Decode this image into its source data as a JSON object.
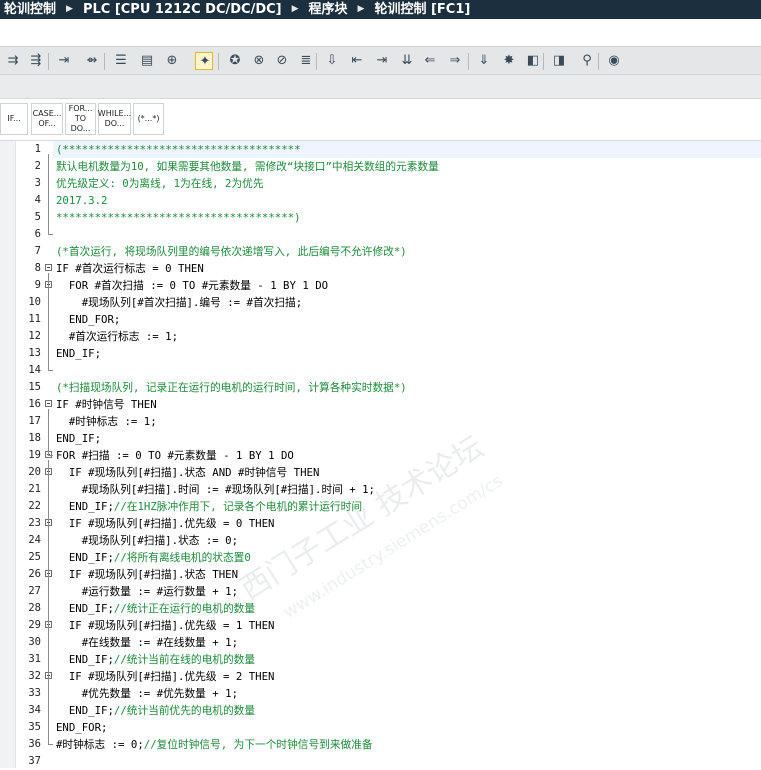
{
  "breadcrumb": {
    "items": [
      "轮训控制",
      "PLC [CPU 1212C DC/DC/DC]",
      "程序块",
      "轮训控制 [FC1]"
    ]
  },
  "toolbar": {
    "icons": [
      "insert-network-icon",
      "delete-network-icon",
      "jump-icon",
      "jump-end-icon",
      "align-left-icon",
      "list-icon",
      "monitor-icon",
      "toggle-icon",
      "absolute-operand-icon",
      "block-call-icon",
      "declaration-icon",
      "list-view-icon",
      "download-icon",
      "indent-increase-icon",
      "indent-decrease-icon",
      "align-icon",
      "comment-icon",
      "uncomment-icon",
      "bookmark-icon",
      "prev-bookmark-icon",
      "next-bookmark-icon",
      "find-icon",
      "watch-icon",
      "settings-icon"
    ]
  },
  "snippets": [
    {
      "label": "IF...",
      "line2": ""
    },
    {
      "label": "CASE...",
      "line2": "OF..."
    },
    {
      "label": "FOR...",
      "line2": "TO DO..."
    },
    {
      "label": "WHILE...",
      "line2": "DO..."
    },
    {
      "label": "(*...*)",
      "line2": ""
    }
  ],
  "watermark": {
    "text1": "西门子工业  技术论坛",
    "text2": "www.industry.siemens.com/cs"
  },
  "code": [
    {
      "n": "1",
      "t": "(*************************************",
      "c": true,
      "f": false
    },
    {
      "n": "2",
      "t": "默认电机数量为10, 如果需要其他数量, 需修改“块接口”中相关数组的元素数量",
      "c": true
    },
    {
      "n": "3",
      "t": "优先级定义: 0为离线, 1为在线, 2为优先",
      "c": true
    },
    {
      "n": "4",
      "t": "2017.3.2",
      "c": true
    },
    {
      "n": "5",
      "t": "*************************************)",
      "c": true
    },
    {
      "n": "6",
      "t": ""
    },
    {
      "n": "7",
      "t": "(*首次运行, 将现场队列里的编号依次递增写入, 此后编号不允许修改*)",
      "c": true
    },
    {
      "n": "8",
      "t": "IF #首次运行标志 = 0 THEN",
      "f": true
    },
    {
      "n": "9",
      "t": "  FOR #首次扫描 := 0 TO #元素数量 - 1 BY 1 DO",
      "f": true
    },
    {
      "n": "10",
      "t": "    #现场队列[#首次扫描].编号 := #首次扫描;"
    },
    {
      "n": "11",
      "t": "  END_FOR;"
    },
    {
      "n": "12",
      "t": "  #首次运行标志 := 1;"
    },
    {
      "n": "13",
      "t": "END_IF;"
    },
    {
      "n": "14",
      "t": ""
    },
    {
      "n": "15",
      "t": "(*扫描现场队列, 记录正在运行的电机的运行时间, 计算各种实时数据*)",
      "c": true
    },
    {
      "n": "16",
      "t": "IF #时钟信号 THEN",
      "f": true
    },
    {
      "n": "17",
      "t": "  #时钟标志 := 1;"
    },
    {
      "n": "18",
      "t": "END_IF;"
    },
    {
      "n": "19",
      "t": "FOR #扫描 := 0 TO #元素数量 - 1 BY 1 DO",
      "f": true
    },
    {
      "n": "20",
      "t": "  IF #现场队列[#扫描].状态 AND #时钟信号 THEN",
      "f": true
    },
    {
      "n": "21",
      "t": "    #现场队列[#扫描].时间 := #现场队列[#扫描].时间 + 1;"
    },
    {
      "n": "22",
      "t": "  END_IF;",
      "cm": "//在1HZ脉冲作用下, 记录各个电机的累计运行时间"
    },
    {
      "n": "23",
      "t": "  IF #现场队列[#扫描].优先级 = 0 THEN",
      "f": true
    },
    {
      "n": "24",
      "t": "    #现场队列[#扫描].状态 := 0;"
    },
    {
      "n": "25",
      "t": "  END_IF;",
      "cm": "//将所有离线电机的状态置0"
    },
    {
      "n": "26",
      "t": "  IF #现场队列[#扫描].状态 THEN",
      "f": true
    },
    {
      "n": "27",
      "t": "    #运行数量 := #运行数量 + 1;"
    },
    {
      "n": "28",
      "t": "  END_IF;",
      "cm": "//统计正在运行的电机的数量"
    },
    {
      "n": "29",
      "t": "  IF #现场队列[#扫描].优先级 = 1 THEN",
      "f": true
    },
    {
      "n": "30",
      "t": "    #在线数量 := #在线数量 + 1;"
    },
    {
      "n": "31",
      "t": "  END_IF;",
      "cm": "//统计当前在线的电机的数量"
    },
    {
      "n": "32",
      "t": "  IF #现场队列[#扫描].优先级 = 2 THEN",
      "f": true
    },
    {
      "n": "33",
      "t": "    #优先数量 := #优先数量 + 1;"
    },
    {
      "n": "34",
      "t": "  END_IF;",
      "cm": "//统计当前优先的电机的数量"
    },
    {
      "n": "35",
      "t": "END_FOR;"
    },
    {
      "n": "36",
      "t": "#时钟标志 := 0;",
      "cm": "//复位时钟信号, 为下一个时钟信号到来做准备"
    },
    {
      "n": "37",
      "t": ""
    }
  ]
}
